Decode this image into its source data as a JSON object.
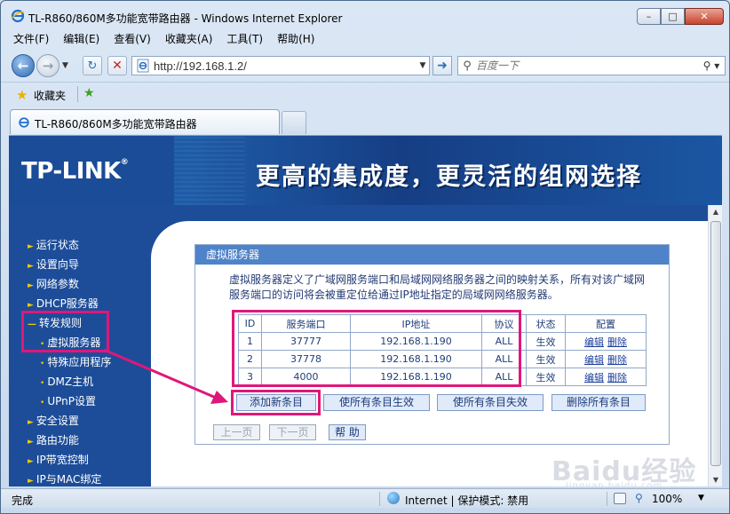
{
  "window": {
    "title": "TL-R860/860M多功能宽带路由器 - Windows Internet Explorer",
    "buttons": [
      "minimize",
      "maximize",
      "close"
    ]
  },
  "menu": [
    "文件(F)",
    "编辑(E)",
    "查看(V)",
    "收藏夹(A)",
    "工具(T)",
    "帮助(H)"
  ],
  "address": {
    "url": "http://192.168.1.2/"
  },
  "search": {
    "placeholder": "百度一下"
  },
  "favorites": {
    "label": "收藏夹"
  },
  "tab": {
    "label": "TL-R860/860M多功能宽带路由器"
  },
  "banner": {
    "logo": "TP-LINK",
    "logo_mark": "®",
    "slogan": "更高的集成度，更灵活的组网选择"
  },
  "sidebar": [
    {
      "label": "运行状态",
      "level": 1
    },
    {
      "label": "设置向导",
      "level": 1
    },
    {
      "label": "网络参数",
      "level": 1
    },
    {
      "label": "DHCP服务器",
      "level": 1
    },
    {
      "label": "转发规则",
      "level": 1,
      "expanded": true
    },
    {
      "label": "虚拟服务器",
      "level": 2,
      "selected": true
    },
    {
      "label": "特殊应用程序",
      "level": 2
    },
    {
      "label": "DMZ主机",
      "level": 2
    },
    {
      "label": "UPnP设置",
      "level": 2
    },
    {
      "label": "安全设置",
      "level": 1
    },
    {
      "label": "路由功能",
      "level": 1
    },
    {
      "label": "IP带宽控制",
      "level": 1
    },
    {
      "label": "IP与MAC绑定",
      "level": 1
    }
  ],
  "panel": {
    "title": "虚拟服务器",
    "description_line1": "虚拟服务器定义了广域网服务端口和局域网网络服务器之间的映射关系，所有对该广域网",
    "description_line2": "服务端口的访问将会被重定位给通过IP地址指定的局域网网络服务器。",
    "table": {
      "headers": [
        "ID",
        "服务端口",
        "IP地址",
        "协议",
        "状态",
        "配置"
      ],
      "rows": [
        {
          "id": "1",
          "port": "37777",
          "ip": "192.168.1.190",
          "protocol": "ALL",
          "status": "生效",
          "edit": "编辑",
          "delete": "删除"
        },
        {
          "id": "2",
          "port": "37778",
          "ip": "192.168.1.190",
          "protocol": "ALL",
          "status": "生效",
          "edit": "编辑",
          "delete": "删除"
        },
        {
          "id": "3",
          "port": "4000",
          "ip": "192.168.1.190",
          "protocol": "ALL",
          "status": "生效",
          "edit": "编辑",
          "delete": "删除"
        }
      ]
    },
    "buttons": {
      "add": "添加新条目",
      "enable_all": "使所有条目生效",
      "disable_all": "使所有条目失效",
      "delete_all": "删除所有条目",
      "prev": "上一页",
      "next": "下一页",
      "help": "帮 助"
    }
  },
  "watermark": {
    "logo": "Baidu经验",
    "sub": "jingyan.baidu.com"
  },
  "status": {
    "text": "完成",
    "zone": "Internet | 保护模式: 禁用",
    "zoom": "100%"
  },
  "colors": {
    "banner": "#1d4d99",
    "header_blue": "#4f83c9",
    "annotation_pink": "#e0177a",
    "menu_bullet": "#f3c700"
  }
}
